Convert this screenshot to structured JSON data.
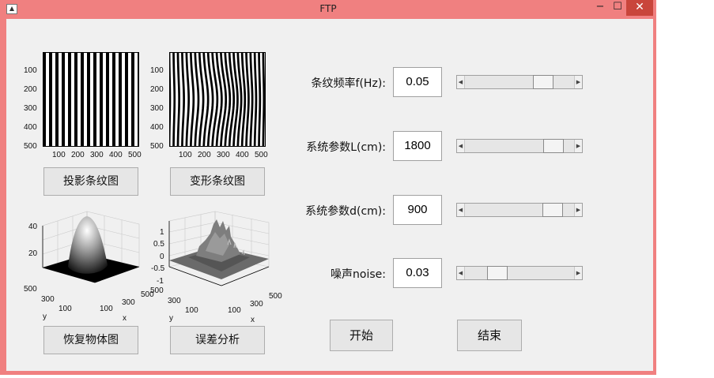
{
  "window": {
    "title": "FTP",
    "min_glyph": "−",
    "max_glyph": "☐",
    "close_glyph": "✕"
  },
  "plots": {
    "projected": {
      "yticks": [
        "100",
        "200",
        "300",
        "400",
        "500"
      ],
      "xticks": [
        "100",
        "200",
        "300",
        "400",
        "500"
      ]
    },
    "deformed": {
      "yticks": [
        "100",
        "200",
        "300",
        "400",
        "500"
      ],
      "xticks": [
        "100",
        "200",
        "300",
        "400",
        "500"
      ]
    },
    "object": {
      "zticks": [
        "40",
        "20"
      ],
      "yticks": [
        "500",
        "300",
        "100"
      ],
      "xticks": [
        "100",
        "300",
        "500"
      ],
      "ylabel": "y",
      "xlabel": "x"
    },
    "error": {
      "zticks": [
        "1",
        "0.5",
        "0",
        "-0.5",
        "-1"
      ],
      "yticks": [
        "500",
        "300",
        "100"
      ],
      "xticks": [
        "100",
        "300",
        "500"
      ],
      "ylabel": "y",
      "xlabel": "x"
    }
  },
  "buttons": {
    "projected": "投影条纹图",
    "deformed": "变形条纹图",
    "recover": "恢复物体图",
    "error": "误差分析",
    "start": "开始",
    "end": "结束"
  },
  "params": [
    {
      "label": "条纹频率f(Hz):",
      "value": "0.05",
      "slider_fraction": 0.76
    },
    {
      "label": "系统参数L(cm):",
      "value": "1800",
      "slider_fraction": 0.88
    },
    {
      "label": "系统参数d(cm):",
      "value": "900",
      "slider_fraction": 0.87
    },
    {
      "label": "噪声noise:",
      "value": "0.03",
      "slider_fraction": 0.25
    }
  ]
}
